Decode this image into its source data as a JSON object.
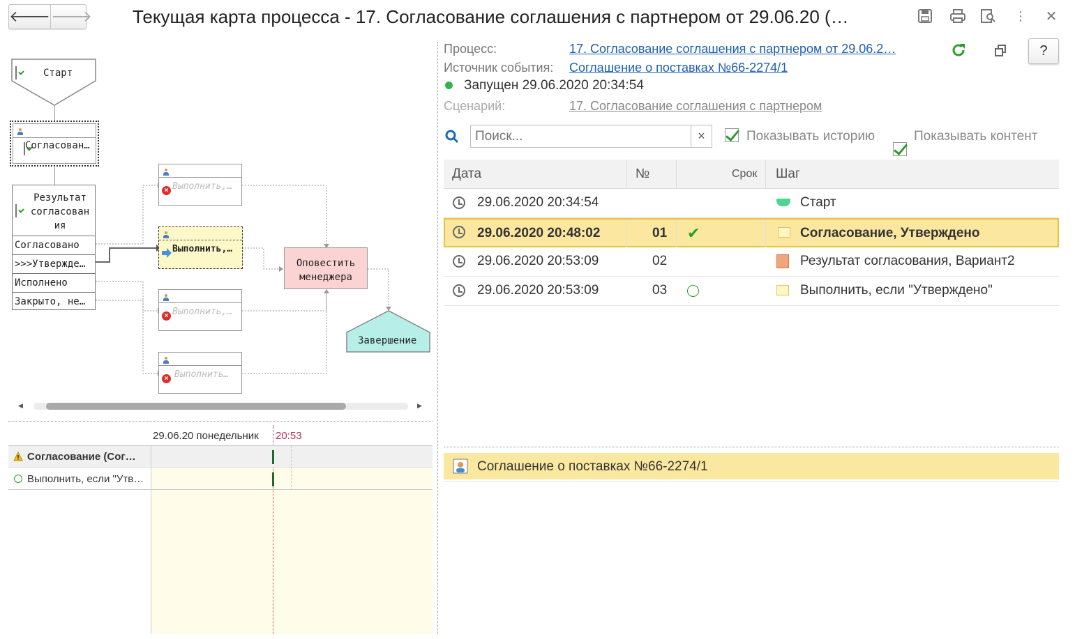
{
  "window": {
    "title": "Текущая карта процесса - 17. Согласование соглашения с партнером от 29.06.20 (…",
    "back_icon": "arrow-left-icon",
    "forward_icon": "arrow-right-icon"
  },
  "diagram": {
    "start": "Старт",
    "approval_task": "Согласован…",
    "result_title_1": "Результат",
    "result_title_2": "согласован",
    "result_title_3": "ия",
    "branch_1": "Согласовано",
    "branch_2": ">>>Утвержде…",
    "branch_3": "Исполнено",
    "branch_4": "Закрыто, не…",
    "task_a": "Выполнить,…",
    "task_b": "Выполнить,…",
    "task_c": "Выполнить,…",
    "task_d": "Выполнить…",
    "notify_1": "Оповестить",
    "notify_2": "менеджера",
    "end": "Завершение"
  },
  "details": {
    "process_label": "Процесс:",
    "process_value": "17. Согласование соглашения с партнером от 29.06.2…",
    "source_label": "Источник события:",
    "source_value": "Соглашение о поставках №66-2274/1",
    "status": "Запущен 29.06.2020 20:34:54",
    "scenario_label": "Сценарий:",
    "scenario_value": "17. Согласование соглашения с партнером",
    "help": "?"
  },
  "search": {
    "placeholder": "Поиск...",
    "clear": "×"
  },
  "options": {
    "show_history": "Показывать историю",
    "show_content": "Показывать контент"
  },
  "table": {
    "columns": [
      "Дата",
      "№",
      "Срок",
      "Шаг"
    ],
    "rows": [
      {
        "date": "29.06.2020 20:34:54",
        "num": "",
        "step": "Старт"
      },
      {
        "date": "29.06.2020 20:48:02",
        "num": "01",
        "step": "Согласование, Утверждено"
      },
      {
        "date": "29.06.2020 20:53:09",
        "num": "02",
        "step": "Результат согласования, Вариант2"
      },
      {
        "date": "29.06.2020 20:53:09",
        "num": "03",
        "step": "Выполнить, если \"Утверждено\""
      }
    ]
  },
  "content": {
    "document": "Соглашение о поставках №66-2274/1"
  },
  "gantt": {
    "date_header": "29.06.20 понедельник",
    "time_marker": "20:53",
    "row_1": "Согласование (Сог…",
    "row_2": "Выполнить, если \"Утв…"
  },
  "colors": {
    "selected_row": "#fbe7a0",
    "notify_box": "#fbd3d3",
    "end_box": "#b7efe8",
    "active_task": "#fdf8c8",
    "link": "#1f5fb0"
  }
}
